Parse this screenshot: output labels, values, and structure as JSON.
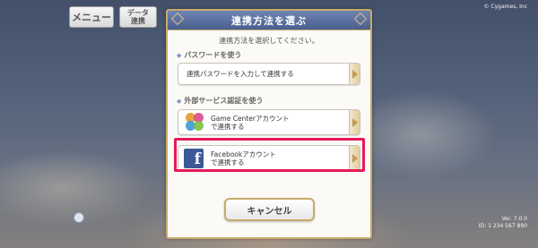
{
  "hud": {
    "menu_label": "メニュー",
    "data_label": "データ\n連携",
    "copyright": "© Cygames, Inc",
    "version_line1": "Ver. 7.0.0",
    "version_line2": "ID: 1 234 567 890"
  },
  "dialog": {
    "title": "連携方法を選ぶ",
    "instruction": "連携方法を選択してください。",
    "password_section": {
      "label": "パスワードを使う",
      "option_label": "連携パスワードを入力して連携する"
    },
    "external_section": {
      "label": "外部サービス認証を使う",
      "options": [
        {
          "icon": "game-center-icon",
          "line1": "Game Centerアカウント",
          "line2": "で連携する"
        },
        {
          "icon": "facebook-icon",
          "line1": "Facebookアカウント",
          "line2": "で連携する"
        }
      ]
    },
    "cancel_label": "キャンセル"
  },
  "colors": {
    "header": "#495f8e",
    "frame_gold": "#c9a96b",
    "highlight": "#e6195a",
    "facebook": "#3b5998"
  }
}
